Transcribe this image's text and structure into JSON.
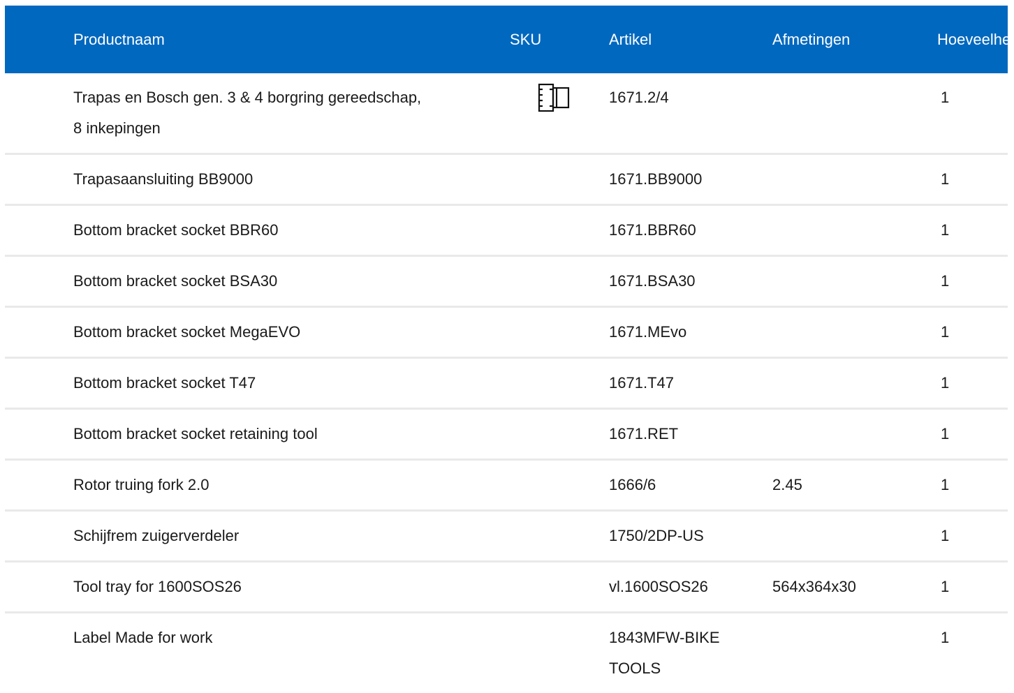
{
  "table": {
    "headers": {
      "name": "Productnaam",
      "sku": "SKU",
      "article": "Artikel",
      "dimensions": "Afmetingen",
      "quantity": "Hoeveelheid"
    },
    "rows": [
      {
        "name": "Trapas en Bosch gen. 3 & 4 borgring gereedschap, 8 inkepingen",
        "sku_icon": "tool-socket-icon",
        "article": "1671.2/4",
        "dimensions": "",
        "quantity": "1"
      },
      {
        "name": "Trapasaansluiting BB9000",
        "article": "1671.BB9000",
        "dimensions": "",
        "quantity": "1"
      },
      {
        "name": "Bottom bracket socket BBR60",
        "article": "1671.BBR60",
        "dimensions": "",
        "quantity": "1"
      },
      {
        "name": "Bottom bracket socket BSA30",
        "article": "1671.BSA30",
        "dimensions": "",
        "quantity": "1"
      },
      {
        "name": "Bottom bracket socket MegaEVO",
        "article": "1671.MEvo",
        "dimensions": "",
        "quantity": "1"
      },
      {
        "name": "Bottom bracket socket T47",
        "article": "1671.T47",
        "dimensions": "",
        "quantity": "1"
      },
      {
        "name": "Bottom bracket socket retaining tool",
        "article": "1671.RET",
        "dimensions": "",
        "quantity": "1"
      },
      {
        "name": "Rotor truing fork 2.0",
        "article": "1666/6",
        "dimensions": "2.45",
        "quantity": "1"
      },
      {
        "name": "Schijfrem zuigerverdeler",
        "article": "1750/2DP-US",
        "dimensions": "",
        "quantity": "1"
      },
      {
        "name": "Tool tray for 1600SOS26",
        "article": "vl.1600SOS26",
        "dimensions": "564x364x30",
        "quantity": "1"
      },
      {
        "name": "Label Made for work",
        "article": "1843MFW-BIKE TOOLS",
        "dimensions": "",
        "quantity": "1"
      }
    ]
  },
  "colors": {
    "header_bg": "#0068bf",
    "header_text": "#ffffff",
    "row_divider": "#e9e9e9"
  }
}
